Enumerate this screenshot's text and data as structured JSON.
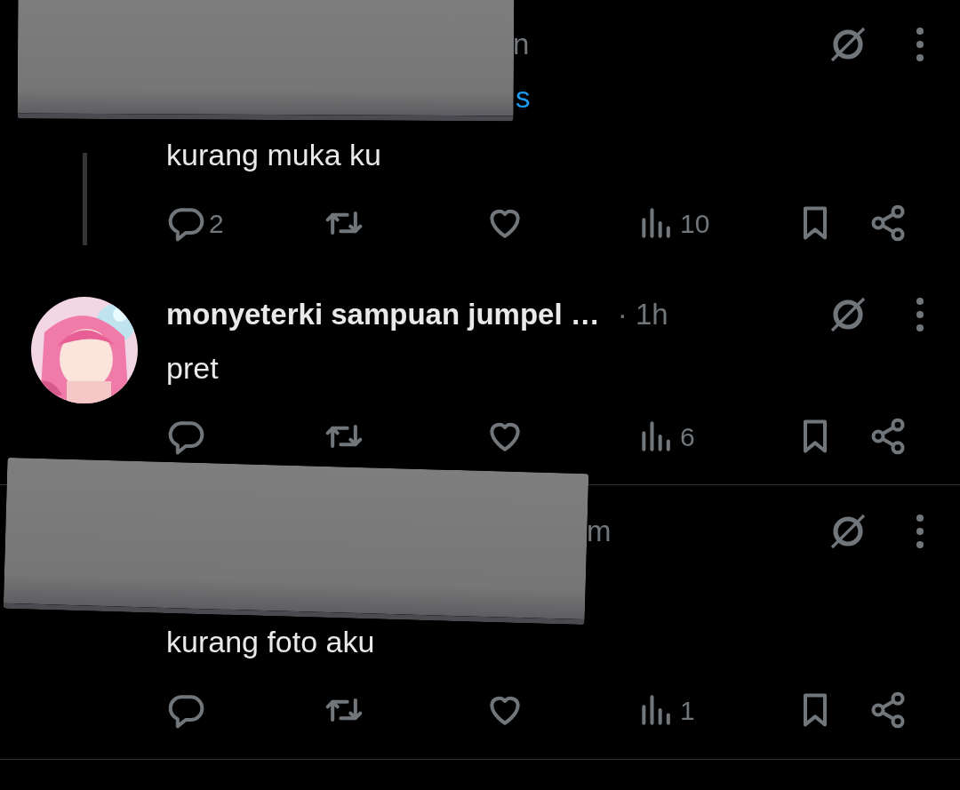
{
  "posts": [
    {
      "redacted": true,
      "name_fragment": "n",
      "handle_fragment": "s",
      "text": "kurang muka ku",
      "thread_line": true,
      "stats": {
        "replies": "2",
        "views": "10"
      }
    },
    {
      "redacted": false,
      "name": "monyeterki sampuan jumpel …",
      "time": "· 1h",
      "text": "pret",
      "thread_line": false,
      "stats": {
        "views": "6"
      }
    },
    {
      "redacted": true,
      "name_fragment": "m",
      "text": "kurang foto aku",
      "thread_line": false,
      "stats": {
        "views": "1"
      }
    }
  ]
}
